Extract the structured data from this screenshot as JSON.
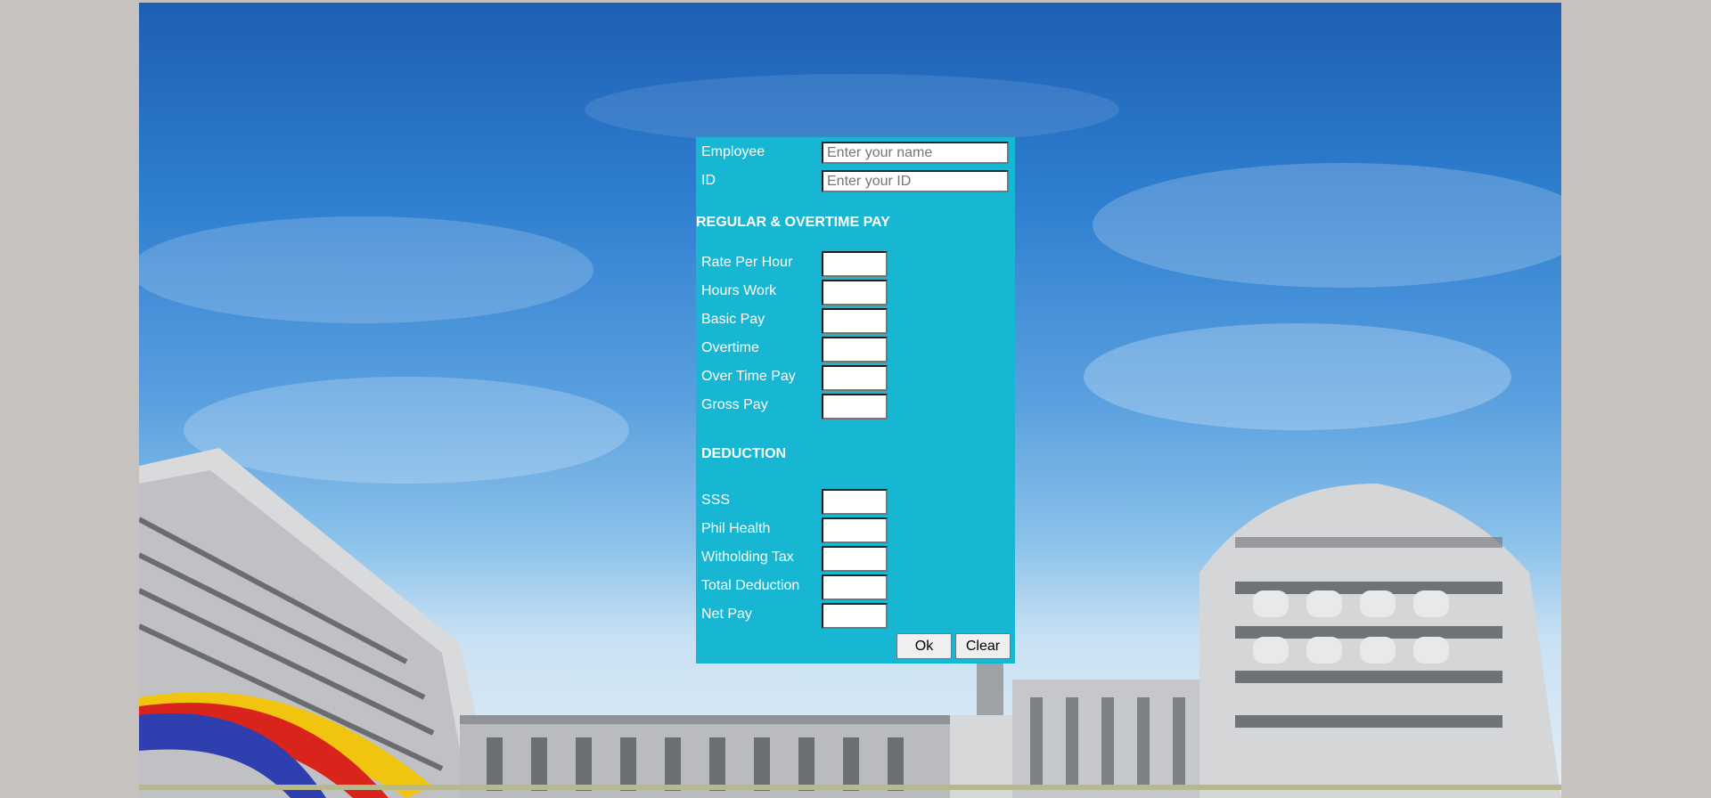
{
  "form": {
    "employee_label": "Employee",
    "employee_placeholder": "Enter your name",
    "id_label": "ID",
    "id_placeholder": "Enter your ID",
    "regular_section": "REGULAR & OVERTIME PAY",
    "rate_per_hour_label": "Rate Per Hour",
    "hours_work_label": "Hours Work",
    "basic_pay_label": "Basic Pay",
    "overtime_label": "Overtime",
    "over_time_pay_label": "Over Time Pay",
    "gross_pay_label": "Gross Pay",
    "deduction_section": "DEDUCTION",
    "sss_label": "SSS",
    "phil_health_label": "Phil Health",
    "witholding_tax_label": "Witholding Tax",
    "total_deduction_label": "Total Deduction",
    "net_pay_label": "Net Pay",
    "ok_label": "Ok",
    "clear_label": "Clear"
  },
  "colors": {
    "form_background": "#17b6d3",
    "page_background": "#c6c2c0",
    "sky": "#2f7fd0"
  }
}
